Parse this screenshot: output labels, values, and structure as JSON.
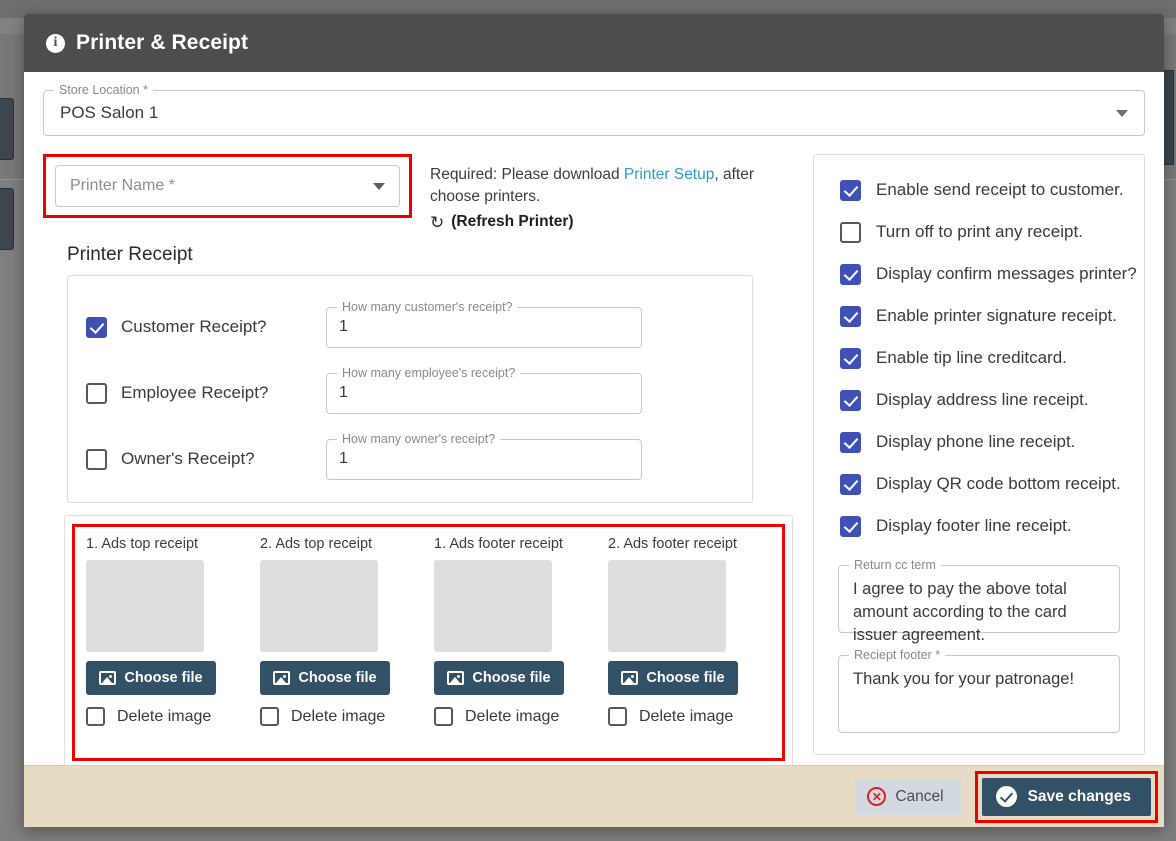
{
  "header": {
    "title": "Printer & Receipt",
    "icon": "info-icon"
  },
  "store_location": {
    "label": "Store Location *",
    "value": "POS Salon 1"
  },
  "printer_name": {
    "label": "Printer Name *",
    "placeholder": "Printer Name *"
  },
  "printer_note": {
    "line1_pre": "Required: Please download ",
    "link": "Printer Setup",
    "line1_post": ", after choose printers.",
    "refresh_label": "(Refresh Printer)",
    "refresh_icon": "refresh-icon"
  },
  "printer_receipt": {
    "section_title": "Printer Receipt",
    "rows": [
      {
        "label": "Customer Receipt?",
        "checked": true,
        "field_label": "How many customer's receipt?",
        "value": "1"
      },
      {
        "label": "Employee Receipt?",
        "checked": false,
        "field_label": "How many employee's receipt?",
        "value": "1"
      },
      {
        "label": "Owner's Receipt?",
        "checked": false,
        "field_label": "How many owner's receipt?",
        "value": "1"
      }
    ]
  },
  "ads": {
    "delete_label": "Delete image",
    "choose_label": "Choose file",
    "columns": [
      {
        "title": "1. Ads top receipt",
        "delete_checked": false
      },
      {
        "title": "2. Ads top receipt",
        "delete_checked": false
      },
      {
        "title": "1. Ads footer receipt",
        "delete_checked": false
      },
      {
        "title": "2. Ads footer receipt",
        "delete_checked": false
      }
    ]
  },
  "options": [
    {
      "label": "Enable send receipt to customer.",
      "checked": true,
      "focused": false
    },
    {
      "label": "Turn off to print any receipt.",
      "checked": false,
      "focused": false
    },
    {
      "label": "Display confirm messages printer?",
      "checked": true,
      "focused": false
    },
    {
      "label": "Enable printer signature receipt.",
      "checked": true,
      "focused": true
    },
    {
      "label": "Enable tip line creditcard.",
      "checked": true,
      "focused": false
    },
    {
      "label": "Display address line receipt.",
      "checked": true,
      "focused": false
    },
    {
      "label": "Display phone line receipt.",
      "checked": true,
      "focused": false
    },
    {
      "label": "Display QR code bottom receipt.",
      "checked": true,
      "focused": false
    },
    {
      "label": "Display footer line receipt.",
      "checked": true,
      "focused": false
    }
  ],
  "return_cc_term": {
    "label": "Return cc term",
    "value": "I agree to pay the above total amount according to the card issuer agreement."
  },
  "receipt_footer": {
    "label": "Reciept footer *",
    "value": "Thank you for your patronage!"
  },
  "footer_actions": {
    "cancel_label": "Cancel",
    "save_label": "Save changes"
  },
  "colors": {
    "header_bg": "#4d4d4d",
    "checkbox_blue": "#3f51b5",
    "button_slate": "#335166",
    "highlight_red": "#ee0000",
    "footer_bg": "#e5dcc3",
    "link_blue": "#2e9bc4"
  }
}
